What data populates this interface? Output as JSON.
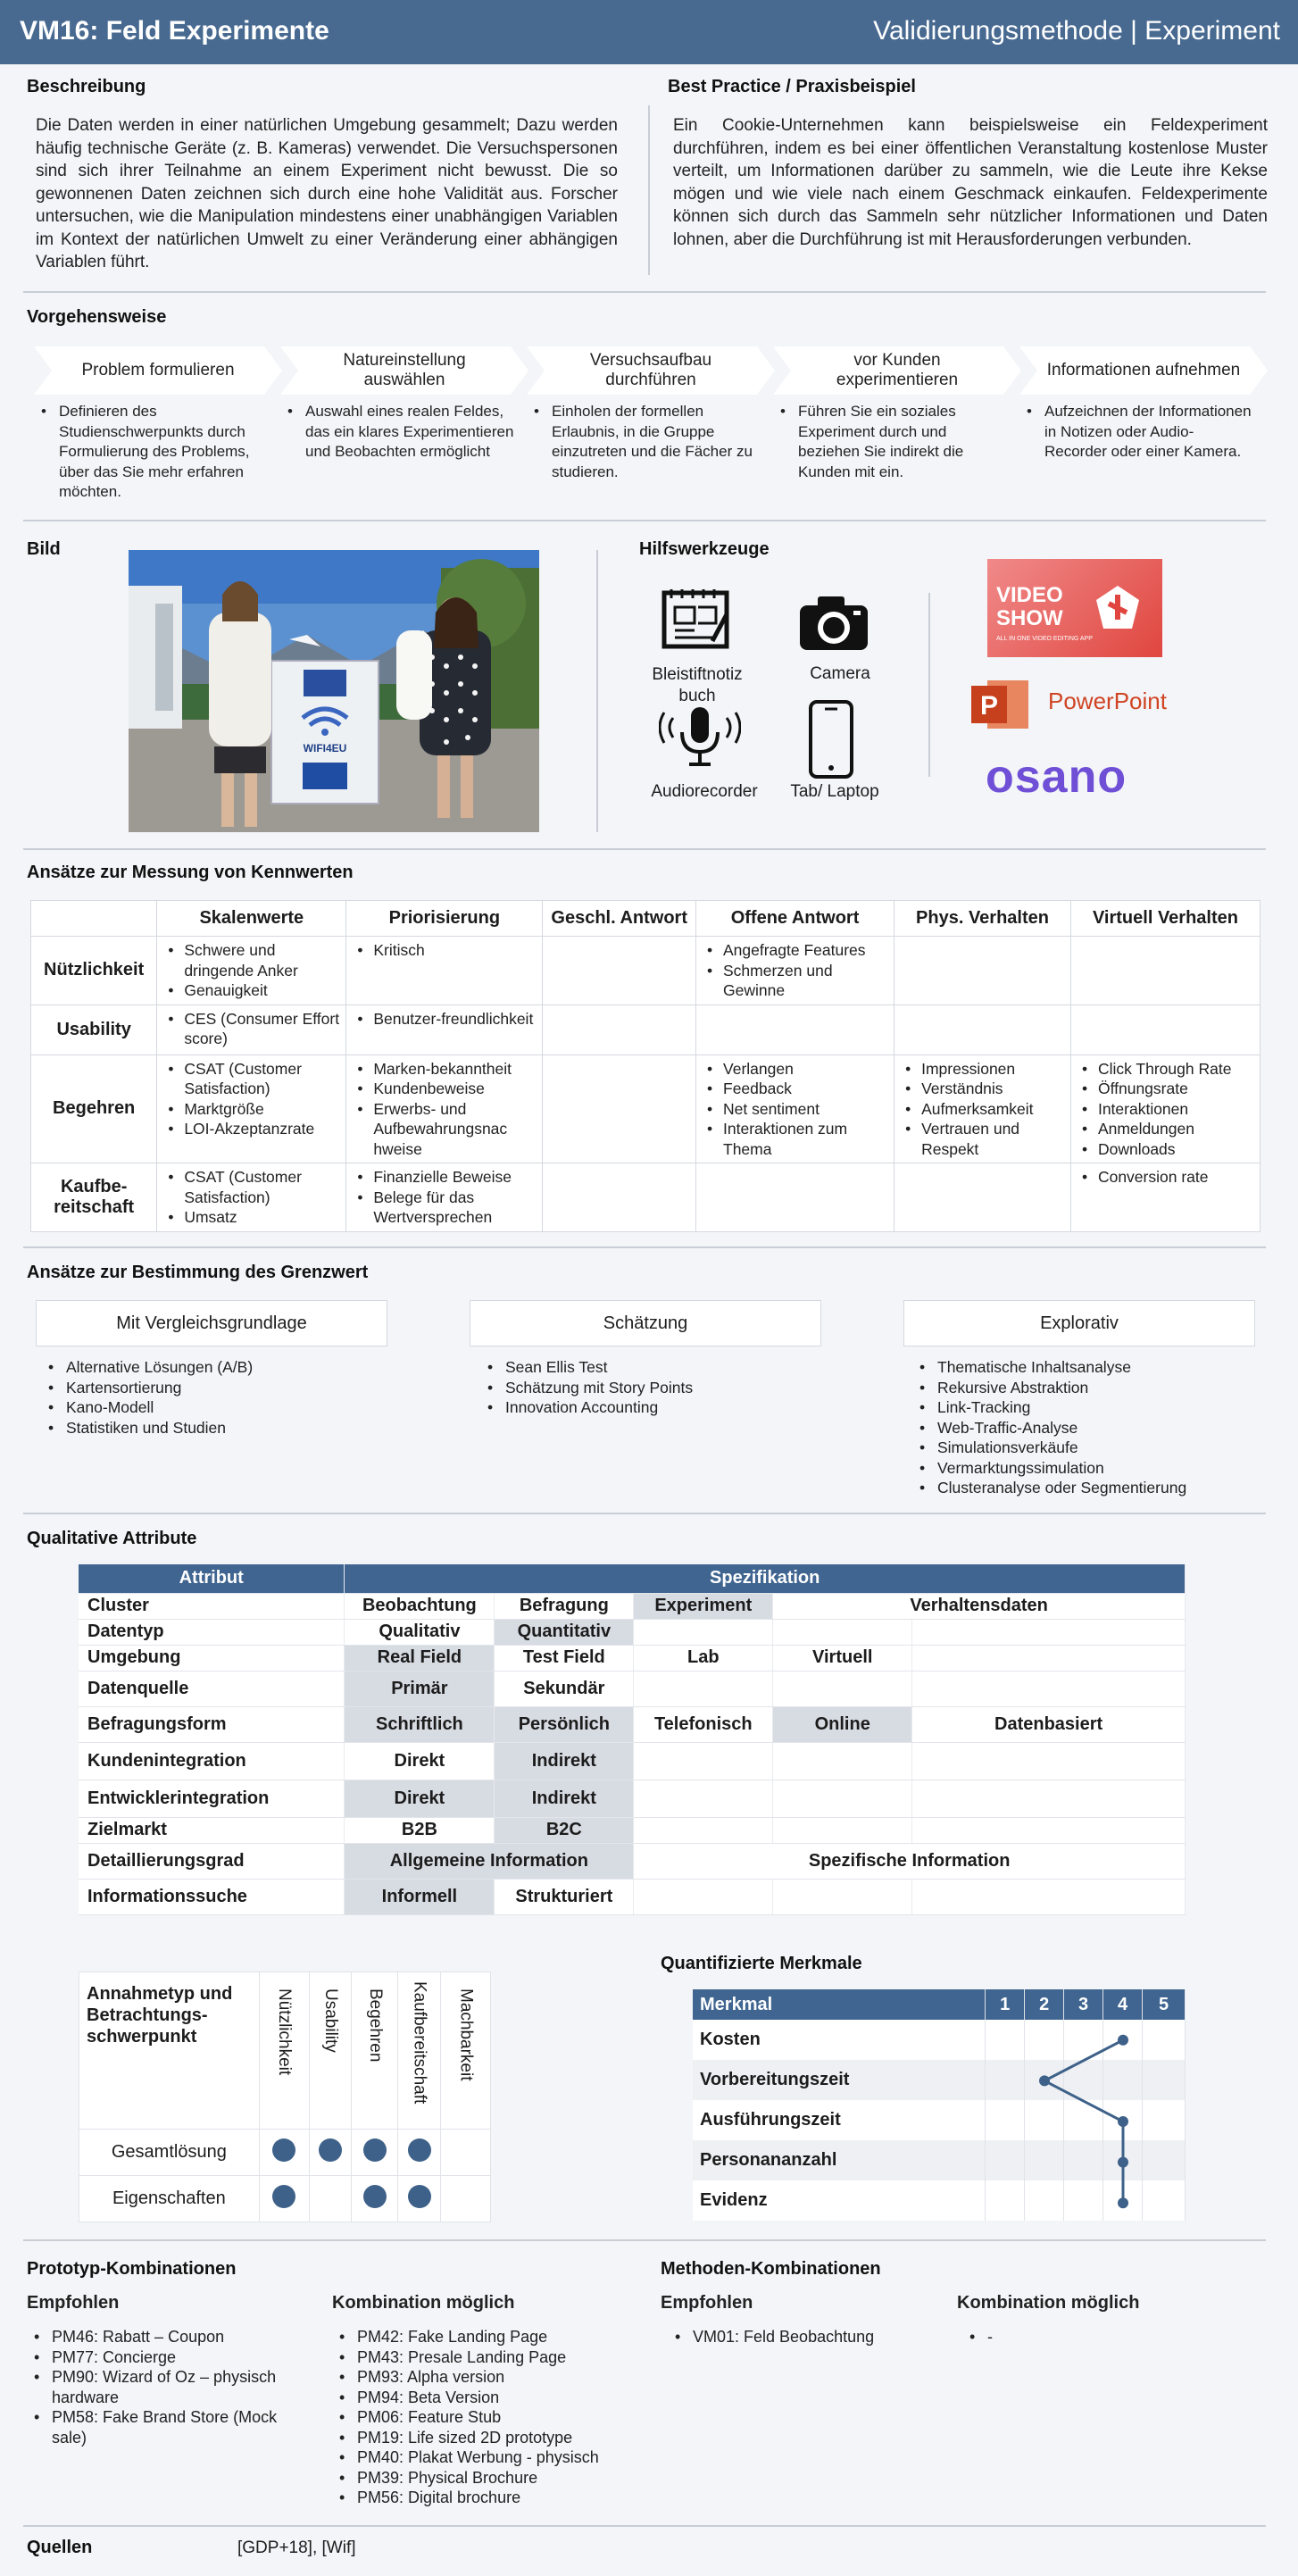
{
  "header": {
    "title": "VM16: Feld Experimente",
    "right": "Validierungsmethode | Experiment"
  },
  "beschreibung": {
    "heading": "Beschreibung",
    "text": "Die Daten werden in einer natürlichen Umgebung gesammelt; Dazu werden häufig technische Geräte (z. B. Kameras) verwendet. Die Versuchspersonen sind sich ihrer Teilnahme an einem Experiment nicht bewusst. Die so gewonnenen Daten zeichnen sich durch eine hohe Validität aus. Forscher untersuchen, wie die Manipulation mindestens einer unabhängigen Variablen im Kontext der natürlichen Umwelt zu einer Veränderung einer abhängigen Variablen führt."
  },
  "best_practice": {
    "heading": "Best Practice / Praxisbeispiel",
    "text": "Ein Cookie-Unternehmen kann beispielsweise ein Feldexperiment durchführen, indem es bei einer öffentlichen Veranstaltung kostenlose Muster verteilt, um Informationen darüber zu sammeln, wie die Leute ihre Kekse mögen und wie viele nach einem Geschmack einkaufen. Feldexperimente können sich durch das Sammeln sehr nützlicher Informationen und Daten lohnen, aber die Durchführung ist mit Herausforderungen verbunden."
  },
  "vorgehensweise": {
    "heading": "Vorgehensweise",
    "steps": [
      {
        "label": "Problem formulieren",
        "desc": "Definieren des Studienschwerpunkts durch Formulierung des Problems, über das Sie mehr erfahren möchten."
      },
      {
        "label": "Natureinstellung auswählen",
        "desc": "Auswahl eines realen Feldes, das ein klares Experimentieren und Beobachten ermöglicht"
      },
      {
        "label": "Versuchsaufbau durchführen",
        "desc": "Einholen der formellen Erlaubnis, in die Gruppe einzutreten und die Fächer zu studieren."
      },
      {
        "label": "vor Kunden experimentieren",
        "desc": "Führen Sie ein soziales Experiment durch und beziehen Sie indirekt die Kunden mit ein."
      },
      {
        "label": "Informationen aufnehmen",
        "desc": "Aufzeichnen der Informationen in Notizen oder Audio-Recorder oder einer Kamera."
      }
    ]
  },
  "bild": {
    "heading": "Bild",
    "sign_text": "WIFI4EU"
  },
  "hilfswerkzeuge": {
    "heading": "Hilfswerkzeuge",
    "tools": [
      "Bleistiftnotiz buch",
      "Camera",
      "Audiorecorder",
      "Tab/ Laptop"
    ],
    "logos": {
      "videoshow": "VIDEO SHOW",
      "videoshow_sub": "ALL IN ONE VIDEO EDITING APP",
      "powerpoint": "PowerPoint",
      "osano": "osano"
    }
  },
  "messung": {
    "heading": "Ansätze zur Messung von Kennwerten",
    "columns": [
      "Skalenwerte",
      "Priorisierung",
      "Geschl. Antwort",
      "Offene Antwort",
      "Phys. Verhalten",
      "Virtuell Verhalten"
    ],
    "rows": [
      {
        "label": "Nützlichkeit",
        "cells": [
          [
            "Schwere und dringende Anker",
            "Genauigkeit"
          ],
          [
            "Kritisch"
          ],
          [],
          [
            "Angefragte Features",
            "Schmerzen und Gewinne"
          ],
          [],
          []
        ]
      },
      {
        "label": "Usability",
        "cells": [
          [
            "CES (Consumer Effort score)"
          ],
          [
            "Benutzer-freundlichkeit"
          ],
          [],
          [],
          [],
          []
        ]
      },
      {
        "label": "Begehren",
        "cells": [
          [
            "CSAT (Customer Satisfaction)",
            "Marktgröße",
            "LOI-Akzeptanzrate"
          ],
          [
            "Marken-bekanntheit",
            "Kundenbeweise",
            "Erwerbs- und Aufbewahrungsnac hweise"
          ],
          [],
          [
            "Verlangen",
            "Feedback",
            "Net sentiment",
            "Interaktionen zum Thema"
          ],
          [
            "Impressionen",
            "Verständnis",
            "Aufmerksamkeit",
            "Vertrauen und Respekt"
          ],
          [
            "Click Through Rate",
            "Öffnungsrate",
            "Interaktionen",
            "Anmeldungen",
            "Downloads"
          ]
        ]
      },
      {
        "label": "Kaufbe-reitschaft",
        "cells": [
          [
            "CSAT (Customer Satisfaction)",
            "Umsatz"
          ],
          [
            "Finanzielle Beweise",
            "Belege für das Wertversprechen"
          ],
          [],
          [],
          [],
          [
            "Conversion rate"
          ]
        ]
      }
    ]
  },
  "grenzwert": {
    "heading": "Ansätze zur Bestimmung des Grenzwert",
    "groups": [
      {
        "title": "Mit Vergleichsgrundlage",
        "items": [
          "Alternative Lösungen (A/B)",
          "Kartensortierung",
          "Kano-Modell",
          "Statistiken und Studien"
        ]
      },
      {
        "title": "Schätzung",
        "items": [
          "Sean Ellis Test",
          "Schätzung mit Story Points",
          "Innovation Accounting"
        ]
      },
      {
        "title": "Explorativ",
        "items": [
          "Thematische Inhaltsanalyse",
          "Rekursive Abstraktion",
          "Link-Tracking",
          "Web-Traffic-Analyse",
          "Simulationsverkäufe",
          "Vermarktungssimulation",
          "Clusteranalyse oder Segmentierung"
        ]
      }
    ]
  },
  "qualitative": {
    "heading": "Qualitative Attribute",
    "col_attribut": "Attribut",
    "col_spez": "Spezifikation",
    "rows": [
      {
        "label": "Cluster",
        "cells": [
          "Beobachtung",
          "Befragung",
          "Experiment",
          "",
          "Verhaltensdaten"
        ]
      },
      {
        "label": "Datentyp",
        "cells": [
          "Qualitativ",
          "Quantitativ",
          "",
          "",
          ""
        ]
      },
      {
        "label": "Umgebung",
        "cells": [
          "Real Field",
          "Test Field",
          "Lab",
          "Virtuell",
          ""
        ]
      },
      {
        "label": "Datenquelle",
        "cells": [
          "Primär",
          "Sekundär",
          "",
          "",
          ""
        ]
      },
      {
        "label": "Befragungsform",
        "cells": [
          "Schriftlich",
          "Persönlich",
          "Telefonisch",
          "Online",
          "Datenbasiert"
        ]
      },
      {
        "label": "Kundenintegration",
        "cells": [
          "Direkt",
          "Indirekt",
          "",
          "",
          ""
        ]
      },
      {
        "label": "Entwicklerintegration",
        "cells": [
          "Direkt",
          "Indirekt",
          "",
          "",
          ""
        ]
      },
      {
        "label": "Zielmarkt",
        "cells": [
          "B2B",
          "B2C",
          "",
          "",
          ""
        ]
      },
      {
        "label": "Detaillierungsgrad",
        "cells": [
          "Allgemeine Information",
          "Spezifische Information"
        ]
      },
      {
        "label": "Informationssuche",
        "cells": [
          "Informell",
          "Strukturiert",
          "",
          "",
          ""
        ]
      }
    ]
  },
  "annahme": {
    "title": "Annahmetyp und Betrachtungs-schwerpunkt",
    "columns": [
      "Nützlichkeit",
      "Usability",
      "Begehren",
      "Kaufbereitschaft",
      "Machbarkeit"
    ],
    "rows": [
      {
        "label": "Gesamtlösung",
        "dots": [
          true,
          true,
          true,
          true,
          false
        ]
      },
      {
        "label": "Eigenschaften",
        "dots": [
          true,
          false,
          true,
          true,
          false
        ]
      }
    ]
  },
  "quant": {
    "heading": "Quantifizierte Merkmale",
    "col": "Merkmal",
    "scale": [
      "1",
      "2",
      "3",
      "4",
      "5"
    ],
    "rows": [
      {
        "label": "Kosten",
        "value": 4
      },
      {
        "label": "Vorbereitungszeit",
        "value": 2
      },
      {
        "label": "Ausführungszeit",
        "value": 4
      },
      {
        "label": "Personananzahl",
        "value": 4
      },
      {
        "label": "Evidenz",
        "value": 4
      }
    ]
  },
  "prototyp": {
    "heading": "Prototyp-Kombinationen",
    "empf_title": "Empfohlen",
    "empf": [
      "PM46: Rabatt – Coupon",
      "PM77: Concierge",
      "PM90: Wizard of Oz – physisch hardware",
      "PM58: Fake Brand Store (Mock sale)"
    ],
    "kombi_title": "Kombination möglich",
    "kombi": [
      "PM42: Fake Landing Page",
      "PM43: Presale Landing Page",
      "PM93: Alpha version",
      "PM94: Beta Version",
      "PM06: Feature Stub",
      "PM19: Life sized 2D prototype",
      "PM40: Plakat Werbung - physisch",
      "PM39: Physical Brochure",
      "PM56: Digital brochure"
    ]
  },
  "methoden": {
    "heading": "Methoden-Kombinationen",
    "empf_title": "Empfohlen",
    "empf": [
      "VM01: Feld Beobachtung"
    ],
    "kombi_title": "Kombination möglich",
    "kombi": [
      "-"
    ]
  },
  "quellen": {
    "label": "Quellen",
    "value": "[GDP+18], [Wif]"
  }
}
